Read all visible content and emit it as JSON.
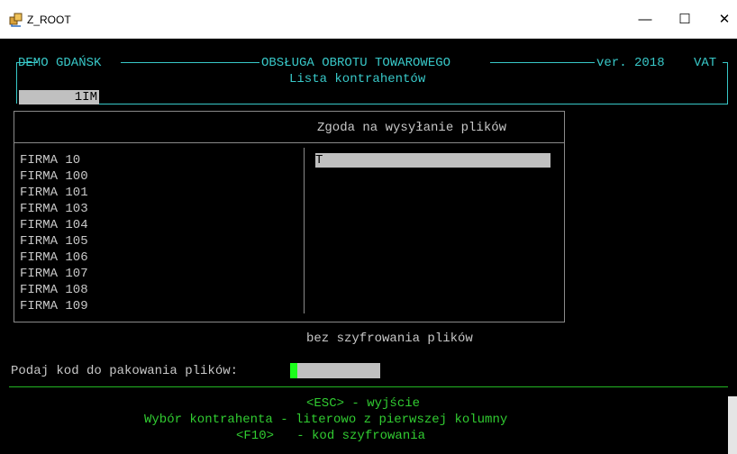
{
  "window": {
    "title": "Z_ROOT",
    "minimize": "—",
    "maximize": "☐",
    "close": "✕"
  },
  "header": {
    "company": "DEMO GDAŃSK",
    "module": "OBSŁUGA OBROTU TOWAROWEGO",
    "version": "ver. 2018",
    "vat": "VAT",
    "subtitle": "Lista kontrahentów",
    "code": "1IM"
  },
  "table": {
    "column_header": "Zgoda na wysyłanie plików",
    "rows": [
      {
        "name": "FIRMA 10",
        "value": "T"
      },
      {
        "name": "FIRMA 100",
        "value": ""
      },
      {
        "name": "FIRMA 101",
        "value": ""
      },
      {
        "name": "FIRMA 103",
        "value": ""
      },
      {
        "name": "FIRMA 104",
        "value": ""
      },
      {
        "name": "FIRMA 105",
        "value": ""
      },
      {
        "name": "FIRMA 106",
        "value": ""
      },
      {
        "name": "FIRMA 107",
        "value": ""
      },
      {
        "name": "FIRMA 108",
        "value": ""
      },
      {
        "name": "FIRMA 109",
        "value": ""
      }
    ]
  },
  "status_text": "bez szyfrowania plików",
  "prompt": {
    "label": "Podaj kod do pakowania plików:",
    "value": ""
  },
  "footer": {
    "line1": "<ESC> - wyjście",
    "line2": "Wybór kontrahenta - literowo z pierwszej kolumny",
    "line3": "<F10>   - kod szyfrowania"
  },
  "colors": {
    "cyan": "#38c8c8",
    "green": "#31cc31",
    "white": "#c8c8c8",
    "highlight": "#c0c0c0"
  }
}
